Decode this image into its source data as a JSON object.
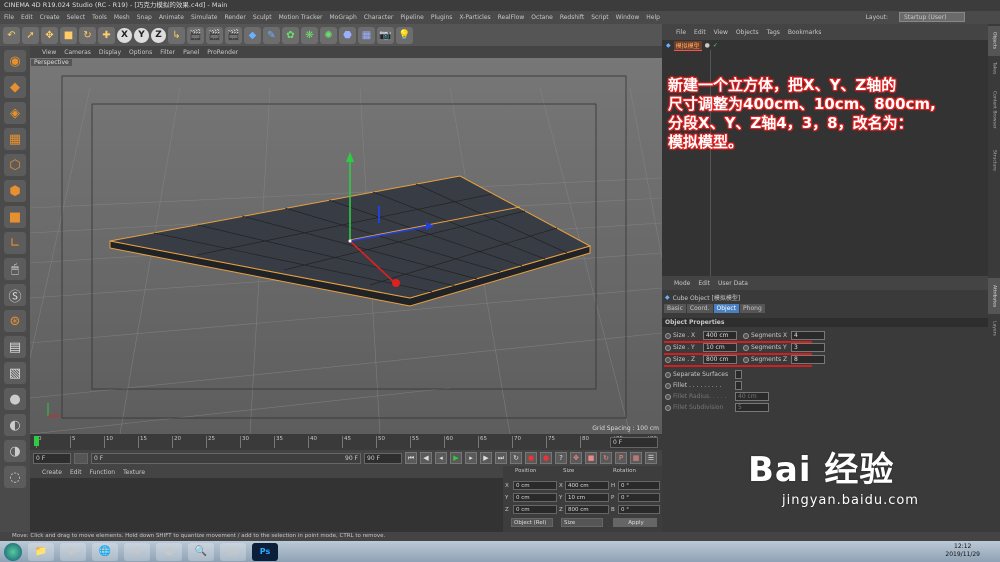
{
  "window": {
    "title": "CINEMA 4D R19.024 Studio (RC - R19) - [巧克力模拟的效果.c4d] - Main"
  },
  "menu": [
    "File",
    "Edit",
    "Create",
    "Select",
    "Tools",
    "Mesh",
    "Snap",
    "Animate",
    "Simulate",
    "Render",
    "Sculpt",
    "Motion Tracker",
    "MoGraph",
    "Character",
    "Pipeline",
    "Plugins",
    "X-Particles",
    "RealFlow",
    "Octane",
    "Redshift",
    "Script",
    "Window",
    "Help"
  ],
  "layout": {
    "label": "Layout:",
    "value": "Startup (User)"
  },
  "toolbar": {
    "x": "X",
    "y": "Y",
    "z": "Z"
  },
  "viewport": {
    "menu": [
      "View",
      "Cameras",
      "Display",
      "Options",
      "Filter",
      "Panel",
      "ProRender"
    ],
    "label": "Perspective",
    "grid_spacing": "Grid Spacing : 100 cm"
  },
  "timeline": {
    "ticks": [
      "0",
      "5",
      "10",
      "15",
      "20",
      "25",
      "30",
      "35",
      "40",
      "45",
      "50",
      "55",
      "60",
      "65",
      "70",
      "75",
      "80",
      "85",
      "90"
    ],
    "end": "0 F"
  },
  "transport": {
    "current": "0 F",
    "start": "0 F",
    "range_end": "90 F",
    "end": "90 F"
  },
  "material": {
    "menu": [
      "Create",
      "Edit",
      "Function",
      "Texture"
    ]
  },
  "coords": {
    "headers": {
      "position": "Position",
      "size": "Size",
      "rotation": "Rotation"
    },
    "rows": [
      {
        "axis": "X",
        "pos": "0 cm",
        "size": "400 cm",
        "rot_axis": "H",
        "rot": "0 °"
      },
      {
        "axis": "Y",
        "pos": "0 cm",
        "size": "10 cm",
        "rot_axis": "P",
        "rot": "0 °"
      },
      {
        "axis": "Z",
        "pos": "0 cm",
        "size": "800 cm",
        "rot_axis": "B",
        "rot": "0 °"
      }
    ],
    "mode": "Object (Rel)",
    "size_mode": "Size",
    "apply": "Apply"
  },
  "objects": {
    "menu": [
      "File",
      "Edit",
      "View",
      "Objects",
      "Tags",
      "Bookmarks"
    ],
    "item": "模拟模型"
  },
  "annotation": [
    "新建一个立方体，把X、Y、Z轴的",
    "尺寸调整为400cm、10cm、800cm,",
    "分段X、Y、Z轴4，3，8，改名为：",
    "模拟模型。"
  ],
  "attributes": {
    "menu": [
      "Mode",
      "Edit",
      "User Data"
    ],
    "object_title": "Cube Object [模拟模型]",
    "tabs": [
      "Basic",
      "Coord.",
      "Object",
      "Phong"
    ],
    "active_tab": "Object",
    "section": "Object Properties",
    "size_x_label": "Size . X",
    "size_x": "400 cm",
    "size_y_label": "Size . Y",
    "size_y": "10 cm",
    "size_z_label": "Size . Z",
    "size_z": "800 cm",
    "seg_x_label": "Segments X",
    "seg_x": "4",
    "seg_y_label": "Segments Y",
    "seg_y": "3",
    "seg_z_label": "Segments Z",
    "seg_z": "8",
    "separate_surfaces": "Separate Surfaces",
    "fillet": "Fillet . . . . . . . . .",
    "fillet_radius_label": "Fillet Radius. . . . .",
    "fillet_radius": "40 cm",
    "fillet_sub_label": "Fillet Subdivision",
    "fillet_sub": "5"
  },
  "right_tabs": [
    "Objects",
    "Takes",
    "Content Browser",
    "Structure",
    "Attributes",
    "Layers"
  ],
  "status": "Move: Click and drag to move elements. Hold down SHIFT to quantize movement / add to the selection in point mode, CTRL to remove.",
  "taskbar": {
    "time": "12:12",
    "date": "2019/11/29",
    "ps": "Ps"
  },
  "watermark": {
    "brand": "Bai 经验",
    "url": "jingyan.baidu.com"
  }
}
